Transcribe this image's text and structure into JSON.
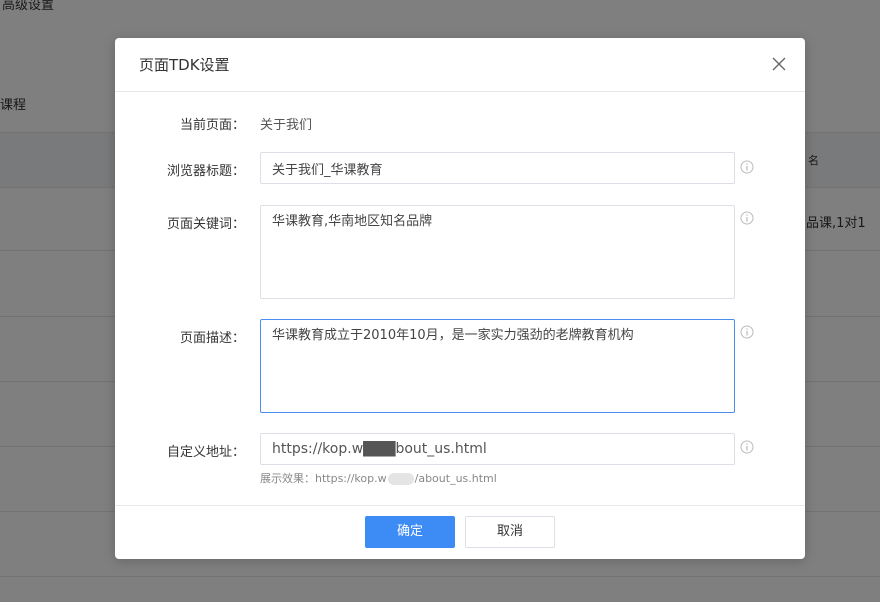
{
  "background": {
    "top_left_text": "高级设置",
    "row_label": "课程",
    "header_cell": "名",
    "row_cell": "品课,1对1"
  },
  "modal": {
    "title": "页面TDK设置",
    "current_page": {
      "label": "当前页面：",
      "value": "关于我们"
    },
    "browser_title": {
      "label": "浏览器标题：",
      "value": "关于我们_华课教育"
    },
    "keywords": {
      "label": "页面关键词：",
      "value": "华课教育,华南地区知名品牌"
    },
    "description": {
      "label": "页面描述：",
      "value": "华课教育成立于2010年10月，是一家实力强劲的老牌教育机构"
    },
    "custom_url": {
      "label": "自定义地址：",
      "value": "https://kop.w███bout_us.html",
      "hint_prefix": "展示效果：https://kop.w",
      "hint_suffix": "/about_us.html"
    },
    "buttons": {
      "confirm": "确定",
      "cancel": "取消"
    }
  },
  "colors": {
    "primary": "#3d8cf5",
    "focus_border": "#4a8ff0",
    "overlay": "rgba(0,0,0,0.5)"
  },
  "icons": {
    "close": "close-icon",
    "info": "info-circle-icon"
  }
}
